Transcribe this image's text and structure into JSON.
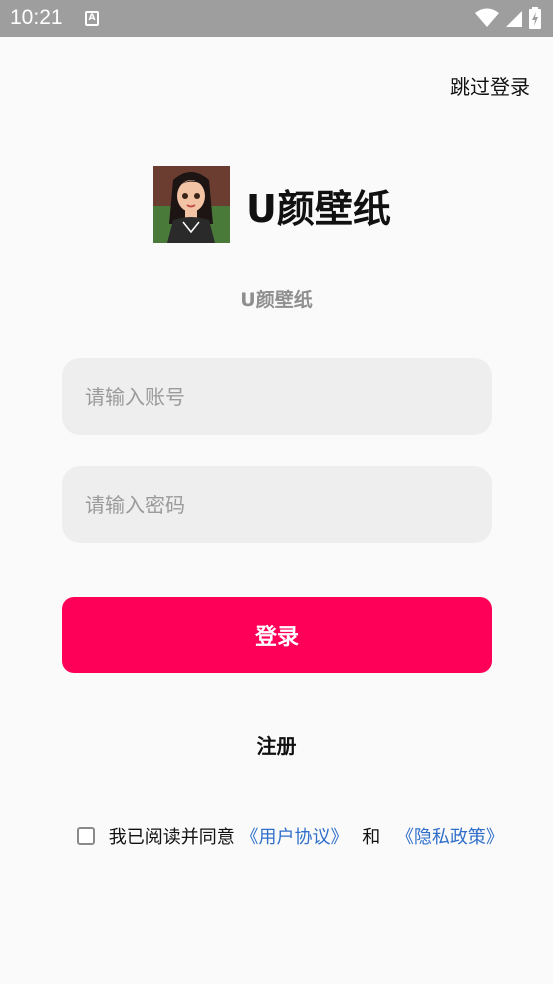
{
  "status_bar": {
    "time": "10:21",
    "notification_icon": "a-badge-icon",
    "icons": [
      "wifi-icon",
      "signal-icon",
      "battery-charging-icon"
    ]
  },
  "header": {
    "skip_login_label": "跳过登录"
  },
  "brand": {
    "title": "U颜壁纸",
    "subtitle": "U颜壁纸"
  },
  "form": {
    "account_placeholder": "请输入账号",
    "password_placeholder": "请输入密码",
    "login_label": "登录",
    "register_label": "注册"
  },
  "agreement": {
    "checked": false,
    "text": "我已阅读并同意",
    "user_agreement": "《用户协议》",
    "and": "和",
    "privacy_policy": "《隐私政策》"
  },
  "colors": {
    "status_bar": "#9e9e9e",
    "primary": "#ff0058",
    "link": "#2f6fc9",
    "field_bg": "#eeeeee"
  }
}
